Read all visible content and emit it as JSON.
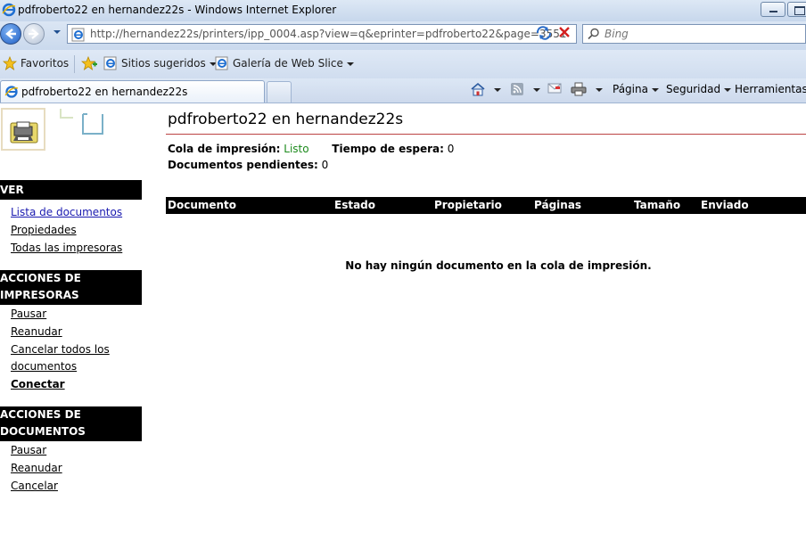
{
  "window": {
    "title": "pdfroberto22 en hernandez22s - Windows Internet Explorer"
  },
  "address": {
    "url": "http://hernandez22s/printers/ipp_0004.asp?view=q&eprinter=pdfroberto22&page=3551",
    "search_placeholder": "Bing"
  },
  "favorites_bar": {
    "favorites_label": "Favoritos",
    "suggested_label": "Sitios sugeridos",
    "webslice_label": "Galería de Web Slice"
  },
  "tabs": {
    "active_label": "pdfroberto22 en hernandez22s"
  },
  "command_bar": {
    "page_label": "Página",
    "security_label": "Seguridad",
    "tools_label": "Herramientas"
  },
  "sidebar": {
    "view_header": "VER",
    "view_links": [
      "Lista de documentos",
      "Propiedades",
      "Todas las impresoras"
    ],
    "printer_actions_header_1": "ACCIONES DE",
    "printer_actions_header_2": "IMPRESORAS",
    "printer_links": [
      "Pausar",
      "Reanudar",
      "Cancelar todos los",
      "documentos",
      "Conectar"
    ],
    "document_actions_header_1": "ACCIONES DE",
    "document_actions_header_2": "DOCUMENTOS",
    "document_links": [
      "Pausar",
      "Reanudar",
      "Cancelar"
    ]
  },
  "main": {
    "title": "pdfroberto22 en hernandez22s",
    "queue_label": "Cola de impresión:",
    "queue_value": "Listo",
    "wait_label": "Tiempo de espera:",
    "wait_value": "0",
    "pending_label": "Documentos pendientes:",
    "pending_value": "0",
    "columns": [
      "Documento",
      "Estado",
      "Propietario",
      "Páginas",
      "Tamaño",
      "Enviado"
    ],
    "empty_message": "No hay ningún documento en la cola de impresión."
  },
  "colors": {
    "ok_status": "#1c8a1c",
    "title_rule": "#b44444",
    "header_bg": "#000000"
  }
}
